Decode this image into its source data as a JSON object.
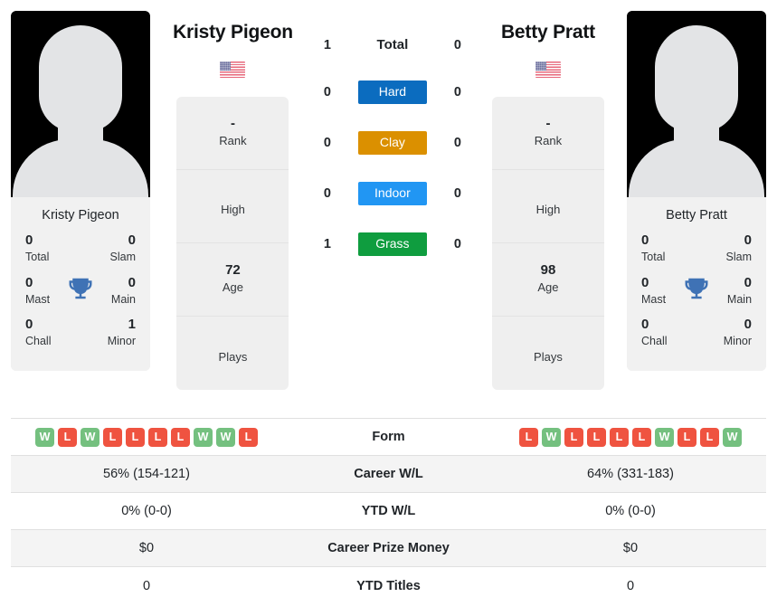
{
  "players": [
    {
      "name": "Kristy Pigeon",
      "flag_icon": "us-flag-icon",
      "photo_caption": "Kristy Pigeon",
      "titles": {
        "total_value": "0",
        "total_label": "Total",
        "slam_value": "0",
        "slam_label": "Slam",
        "mast_value": "0",
        "mast_label": "Mast",
        "main_value": "0",
        "main_label": "Main",
        "chall_value": "0",
        "chall_label": "Chall",
        "minor_value": "1",
        "minor_label": "Minor",
        "trophy_icon": "trophy-icon"
      },
      "info": [
        {
          "value": "-",
          "label": "Rank"
        },
        {
          "value": "",
          "label": "High"
        },
        {
          "value": "72",
          "label": "Age"
        },
        {
          "value": "",
          "label": "Plays"
        }
      ],
      "h2h": {
        "total": "1",
        "hard": "0",
        "clay": "0",
        "indoor": "0",
        "grass": "1"
      },
      "form": [
        "W",
        "L",
        "W",
        "L",
        "L",
        "L",
        "L",
        "W",
        "W",
        "L"
      ],
      "career_wl": "56% (154-121)",
      "ytd_wl": "0% (0-0)",
      "career_prize_money": "$0",
      "ytd_titles": "0"
    },
    {
      "name": "Betty Pratt",
      "flag_icon": "us-flag-icon",
      "photo_caption": "Betty Pratt",
      "titles": {
        "total_value": "0",
        "total_label": "Total",
        "slam_value": "0",
        "slam_label": "Slam",
        "mast_value": "0",
        "mast_label": "Mast",
        "main_value": "0",
        "main_label": "Main",
        "chall_value": "0",
        "chall_label": "Chall",
        "minor_value": "0",
        "minor_label": "Minor",
        "trophy_icon": "trophy-icon"
      },
      "info": [
        {
          "value": "-",
          "label": "Rank"
        },
        {
          "value": "",
          "label": "High"
        },
        {
          "value": "98",
          "label": "Age"
        },
        {
          "value": "",
          "label": "Plays"
        }
      ],
      "h2h": {
        "total": "0",
        "hard": "0",
        "clay": "0",
        "indoor": "0",
        "grass": "0"
      },
      "form": [
        "L",
        "W",
        "L",
        "L",
        "L",
        "L",
        "W",
        "L",
        "L",
        "W"
      ],
      "career_wl": "64% (331-183)",
      "ytd_wl": "0% (0-0)",
      "career_prize_money": "$0",
      "ytd_titles": "0"
    }
  ],
  "surfaces": [
    {
      "key": "total",
      "label": "Total",
      "color": "transparent"
    },
    {
      "key": "hard",
      "label": "Hard",
      "color": "#0b6cbf"
    },
    {
      "key": "clay",
      "label": "Clay",
      "color": "#db9000"
    },
    {
      "key": "indoor",
      "label": "Indoor",
      "color": "#2196f3"
    },
    {
      "key": "grass",
      "label": "Grass",
      "color": "#0f9d3f"
    }
  ],
  "stats_rows": [
    {
      "label": "Form",
      "type": "form"
    },
    {
      "label": "Career W/L",
      "type": "text",
      "key": "career_wl"
    },
    {
      "label": "YTD W/L",
      "type": "text",
      "key": "ytd_wl"
    },
    {
      "label": "Career Prize Money",
      "type": "text",
      "key": "career_prize_money"
    },
    {
      "label": "YTD Titles",
      "type": "text",
      "key": "ytd_titles"
    }
  ],
  "colors": {
    "win_badge": "#74c07f",
    "loss_badge": "#ef5340",
    "trophy": "#3f72b5",
    "card_bg": "#efefef",
    "row_alt_bg": "#f4f4f4"
  }
}
